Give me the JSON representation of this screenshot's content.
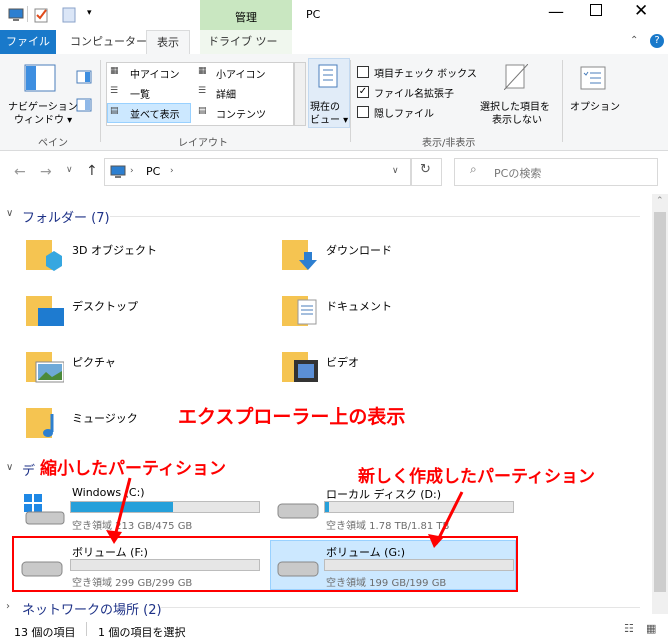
{
  "window": {
    "title": "PC",
    "context_tab": "管理",
    "tabs": [
      "ファイル",
      "コンピューター",
      "表示",
      "ドライブ ツール"
    ]
  },
  "ribbon": {
    "pane_group": {
      "nav_pane_line1": "ナビゲーション",
      "nav_pane_line2": "ウィンドウ ▾",
      "label": "ペイン"
    },
    "layout_group": {
      "items": [
        "中アイコン",
        "小アイコン",
        "一覧",
        "詳細",
        "並べて表示",
        "コンテンツ"
      ],
      "label": "レイアウト"
    },
    "current_view": {
      "line1": "現在の",
      "line2": "ビュー ▾"
    },
    "show_hide": {
      "item_checkboxes": "項目チェック ボックス",
      "file_ext": "ファイル名拡張子",
      "hidden_files": "隠しファイル",
      "hide_selected_line1": "選択した項目を",
      "hide_selected_line2": "表示しない",
      "label": "表示/非表示"
    },
    "options": "オプション"
  },
  "address": {
    "path": "PC",
    "search_placeholder": "PCの検索"
  },
  "folders": {
    "header": "フォルダー (7)",
    "items": [
      "3D オブジェクト",
      "ダウンロード",
      "デスクトップ",
      "ドキュメント",
      "ピクチャ",
      "ビデオ",
      "ミュージック"
    ]
  },
  "devices": {
    "header_visible": "デ",
    "drives": [
      {
        "name": "Windows (C:)",
        "free": "空き領域 213 GB/475 GB",
        "used_fraction": 0.55
      },
      {
        "name": "ローカル ディスク (D:)",
        "free": "空き領域 1.78 TB/1.81 TB",
        "used_fraction": 0.02
      },
      {
        "name": "ボリューム (F:)",
        "free": "空き領域 299 GB/299 GB",
        "used_fraction": 0.0
      },
      {
        "name": "ボリューム (G:)",
        "free": "空き領域 199 GB/199 GB",
        "used_fraction": 0.0
      }
    ]
  },
  "network": {
    "header": "ネットワークの場所 (2)"
  },
  "status": {
    "count": "13 個の項目",
    "selected": "1 個の項目を選択"
  },
  "annotations": {
    "explorer": "エクスプローラー上の表示",
    "shrunk": "縮小したパーティション",
    "new": "新しく作成したパーティション"
  },
  "colors": {
    "accent": "#1979ca",
    "context_tab": "#c9e7c1",
    "selection": "#cce8ff",
    "annotation": "#ff0000",
    "bar": "#26a0da"
  }
}
